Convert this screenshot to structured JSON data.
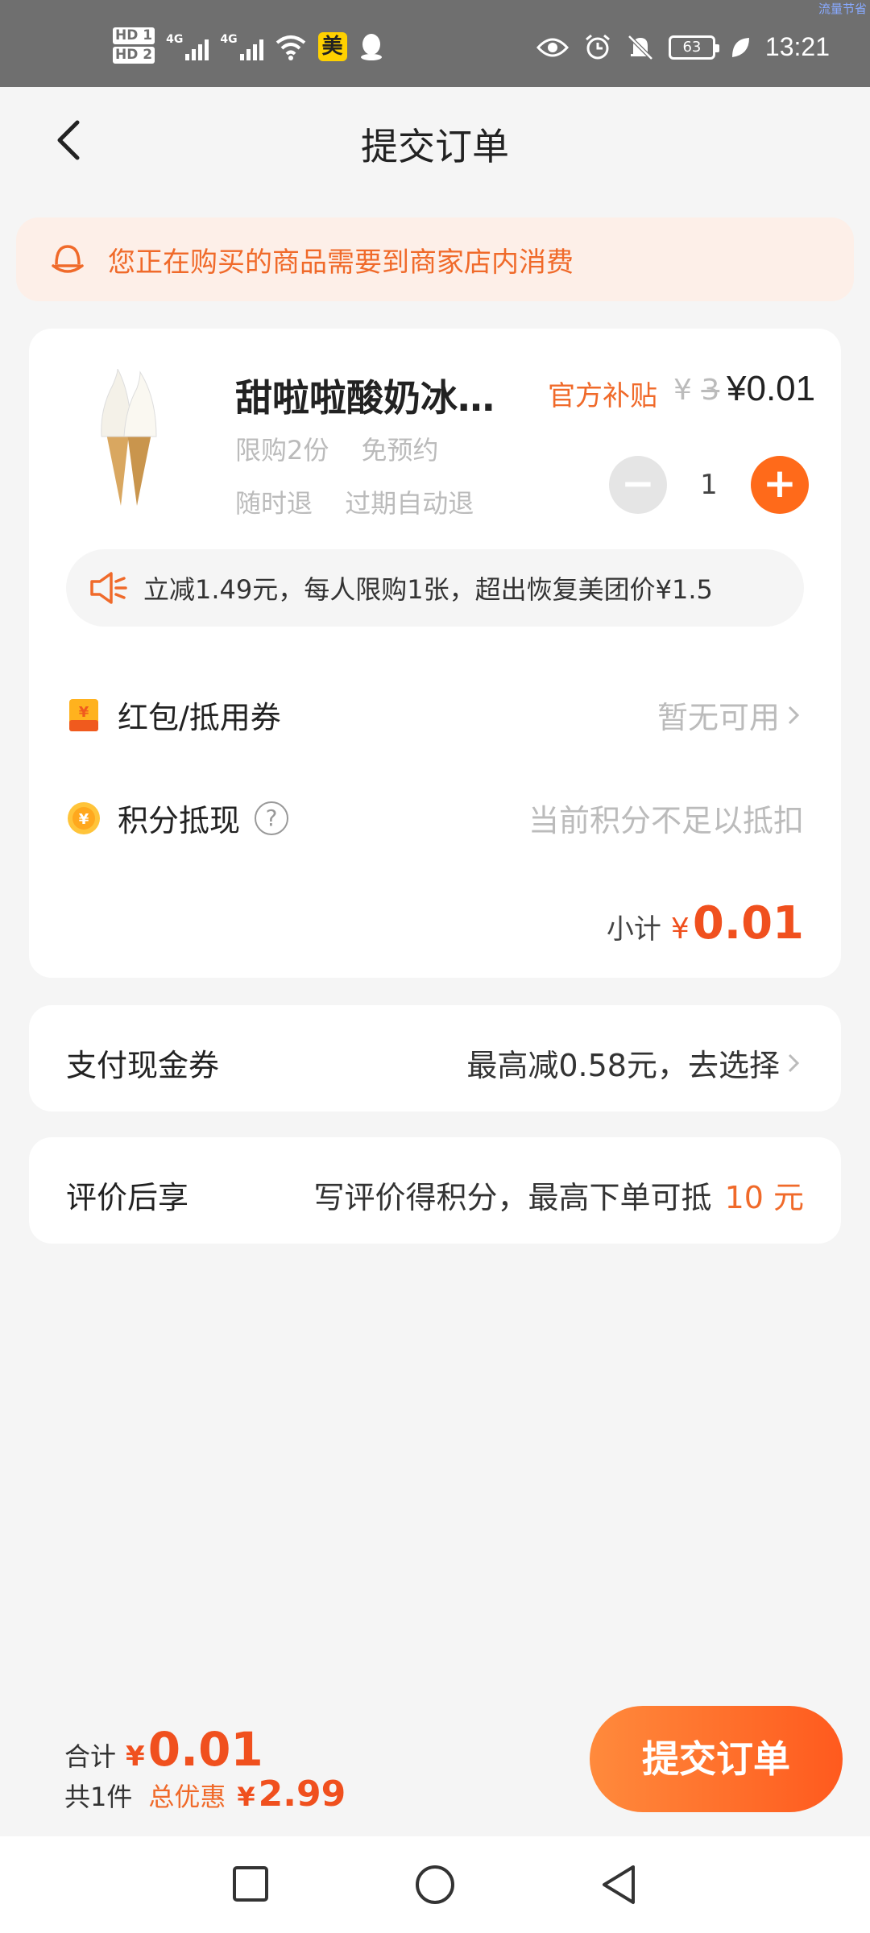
{
  "status_bar": {
    "sim1": "HD 1",
    "sim2": "HD 2",
    "network1": "4G",
    "network2": "4G",
    "app_badge": "美",
    "battery": "63",
    "time": "13:21",
    "corner_label": "流量节省"
  },
  "nav": {
    "title": "提交订单"
  },
  "notice": {
    "text": "您正在购买的商品需要到商家店内消费"
  },
  "product": {
    "name": "甜啦啦酸奶冰…",
    "subsidy_label": "官方补贴",
    "original_currency": "¥",
    "original_price": "3",
    "price": "¥0.01",
    "tag_limit": "限购2份",
    "tag_no_reservation": "免预约",
    "tag_refund_anytime": "随时退",
    "tag_auto_refund": "过期自动退",
    "quantity": "1",
    "minus_symbol": "−",
    "plus_symbol": "+",
    "promo_text": "立减1.49元，每人限购1张，超出恢复美团价¥1.5"
  },
  "discounts": {
    "coupon_label": "红包/抵用券",
    "coupon_value": "暂无可用",
    "points_label": "积分抵现",
    "points_help": "?",
    "points_value": "当前积分不足以抵扣",
    "subtotal_label": "小计",
    "subtotal_currency": "¥",
    "subtotal_value": "0.01"
  },
  "payment_coupon": {
    "label": "支付现金券",
    "value": "最高减0.58元，去选择"
  },
  "review": {
    "label": "评价后享",
    "value": "写评价得积分，最高下单可抵",
    "amount": "10 元"
  },
  "footer": {
    "total_label": "合计",
    "total_currency": "¥",
    "total_value": "0.01",
    "count_label": "共1件",
    "discount_label": "总优惠",
    "discount_currency": "¥",
    "discount_value": "2.99",
    "submit_label": "提交订单"
  },
  "colors": {
    "accent": "#f06a2a",
    "price": "#f0501e",
    "notice_bg": "#fdefe8"
  }
}
